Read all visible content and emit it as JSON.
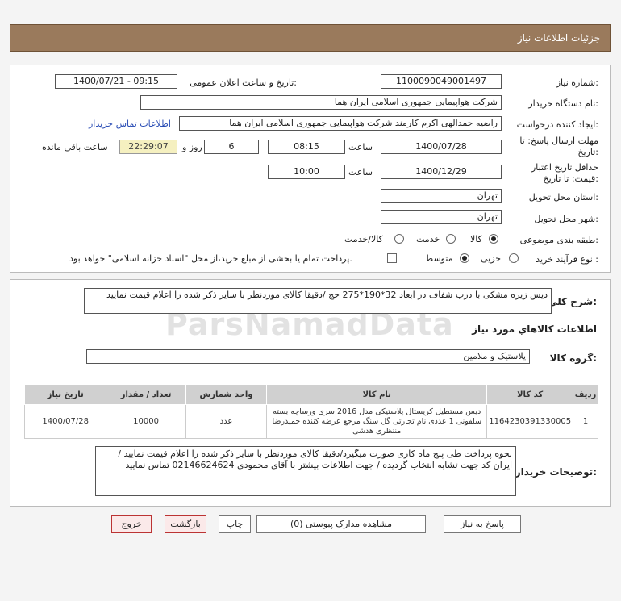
{
  "header": {
    "title": "جزئیات اطلاعات نیاز"
  },
  "form": {
    "need_number_label": "شماره نیاز:",
    "need_number": "1100090049001497",
    "announce_label": "تاریخ و ساعت اعلان عمومی:",
    "announce_value": "1400/07/21 - 09:15",
    "buyer_org_label": "نام دستگاه خریدار:",
    "buyer_org": "شرکت هواپیمایی جمهوری اسلامی ایران هما",
    "creator_label": "ایجاد کننده درخواست:",
    "creator": "راضیه حمدالهی اکرم کارمند شرکت هواپیمایی جمهوری اسلامی ایران هما",
    "contact_link": "اطلاعات تماس خریدار",
    "deadline_label_1": "مهلت ارسال پاسخ: تا",
    "deadline_label_2": "تاریخ:",
    "deadline_date": "1400/07/28",
    "time_label": "ساعت",
    "deadline_time": "08:15",
    "days_value": "6",
    "days_label": "روز و",
    "remaining_time": "22:29:07",
    "remaining_label": "ساعت باقی مانده",
    "validity_label_1": "حداقل تاریخ اعتبار",
    "validity_label_2": "قیمت: تا تاریخ:",
    "validity_date": "1400/12/29",
    "validity_time": "10:00",
    "province_label": "استان محل تحویل:",
    "province": "تهران",
    "city_label": "شهر محل تحویل:",
    "city": "تهران",
    "category_label": "طبقه بندی موضوعی:",
    "category_options": [
      "کالا",
      "خدمت",
      "کالا/خدمت"
    ],
    "process_label": "نوع فرآیند خرید :",
    "process_options": [
      "جزیی",
      "متوسط"
    ],
    "payment_note": "پرداخت تمام یا بخشی از مبلغ خرید،از محل \"اسناد خزانه اسلامی\" خواهد بود."
  },
  "summary": {
    "label": "شرح كلي نياز:",
    "text": "دیس زیره مشکی با درب شفاف در ابعاد 32*190*275  حج /دقیقا کالای موردنظر با سایز ذکر شده را اعلام قیمت نمایید"
  },
  "goods": {
    "section_title": "اطلاعات كالاهاي مورد نياز",
    "group_label": "گروه کالا:",
    "group_value": "پلاستیک و ملامین",
    "columns": [
      "ردیف",
      "کد کالا",
      "نام کالا",
      "واحد شمارش",
      "تعداد / مقدار",
      "تاریخ نیاز"
    ],
    "rows": [
      {
        "row": "1",
        "code": "1164230391330005",
        "name": "دیس مستطیل کریستال پلاستیکی مدل 2016 سری ورساچه بسته سلفونی 1 عددی نام تجارتی گل سنگ مرجع عرضه کننده حمیدرضا منتظری هدشی",
        "unit": "عدد",
        "qty": "10000",
        "date": "1400/07/28"
      }
    ]
  },
  "buyer_notes": {
    "label": "توضیحات خریدار:",
    "text": "نحوه پرداخت طی پنج ماه کاری صورت میگیرد/دقیقا کالای موردنظر با سایز ذکر شده را اعلام قیمت نمایید / ایران کد جهت تشابه انتخاب گردیده / جهت اطلاعات بیشتر با آقای محمودی 02146624624 تماس نمایید"
  },
  "buttons": {
    "reply": "پاسخ به نیاز",
    "view_docs": "مشاهده مدارک پیوستی (0)",
    "print": "چاپ",
    "back": "بازگشت",
    "exit": "خروج"
  },
  "colors": {
    "titlebar": "#9a7a5c",
    "table_header": "#d0d0d0",
    "remaining_bg": "#f5f0c0",
    "link": "#2a4db5"
  }
}
